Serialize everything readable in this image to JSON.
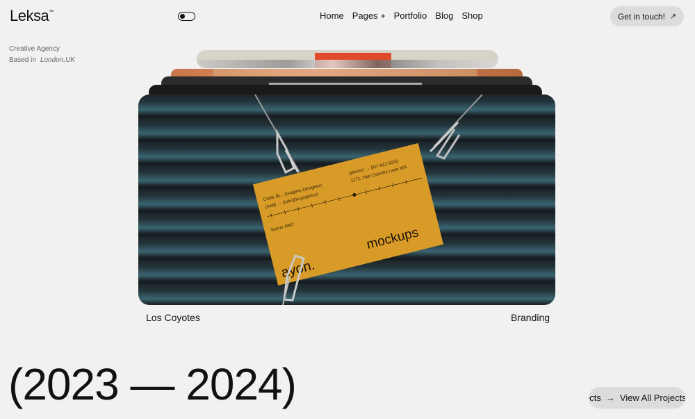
{
  "header": {
    "logo": "Leksa",
    "logo_mark": "™",
    "nav": [
      {
        "label": "Home"
      },
      {
        "label": "Pages",
        "suffix": "+"
      },
      {
        "label": "Portfolio"
      },
      {
        "label": "Blog"
      },
      {
        "label": "Shop"
      }
    ],
    "cta_label": "Get in touch!",
    "cta_icon": "↗"
  },
  "intro": {
    "tagline": "Creative Agency",
    "based_label": "Based in",
    "city": "London,UK"
  },
  "featured": {
    "card_texts": {
      "contact": "Codie Bl... (Graphic Designer)",
      "mail": "(mail) → (info@ls.graphics)",
      "phone": "(phone) → 507-412-9232",
      "address": "1171, Hart Country Lane MN",
      "scene": "Scene #007",
      "brand": "ayon.",
      "headline": "mockups"
    },
    "project_name": "Los Coyotes",
    "project_category": "Branding"
  },
  "years": "(2023 — 2024)",
  "view_all": {
    "ghost": "ects",
    "arrow": "→",
    "label": "View All Projects"
  },
  "colors": {
    "background": "#f1f1f1",
    "card_yellow": "#d99b28",
    "button_bg": "#dcdcdc"
  }
}
